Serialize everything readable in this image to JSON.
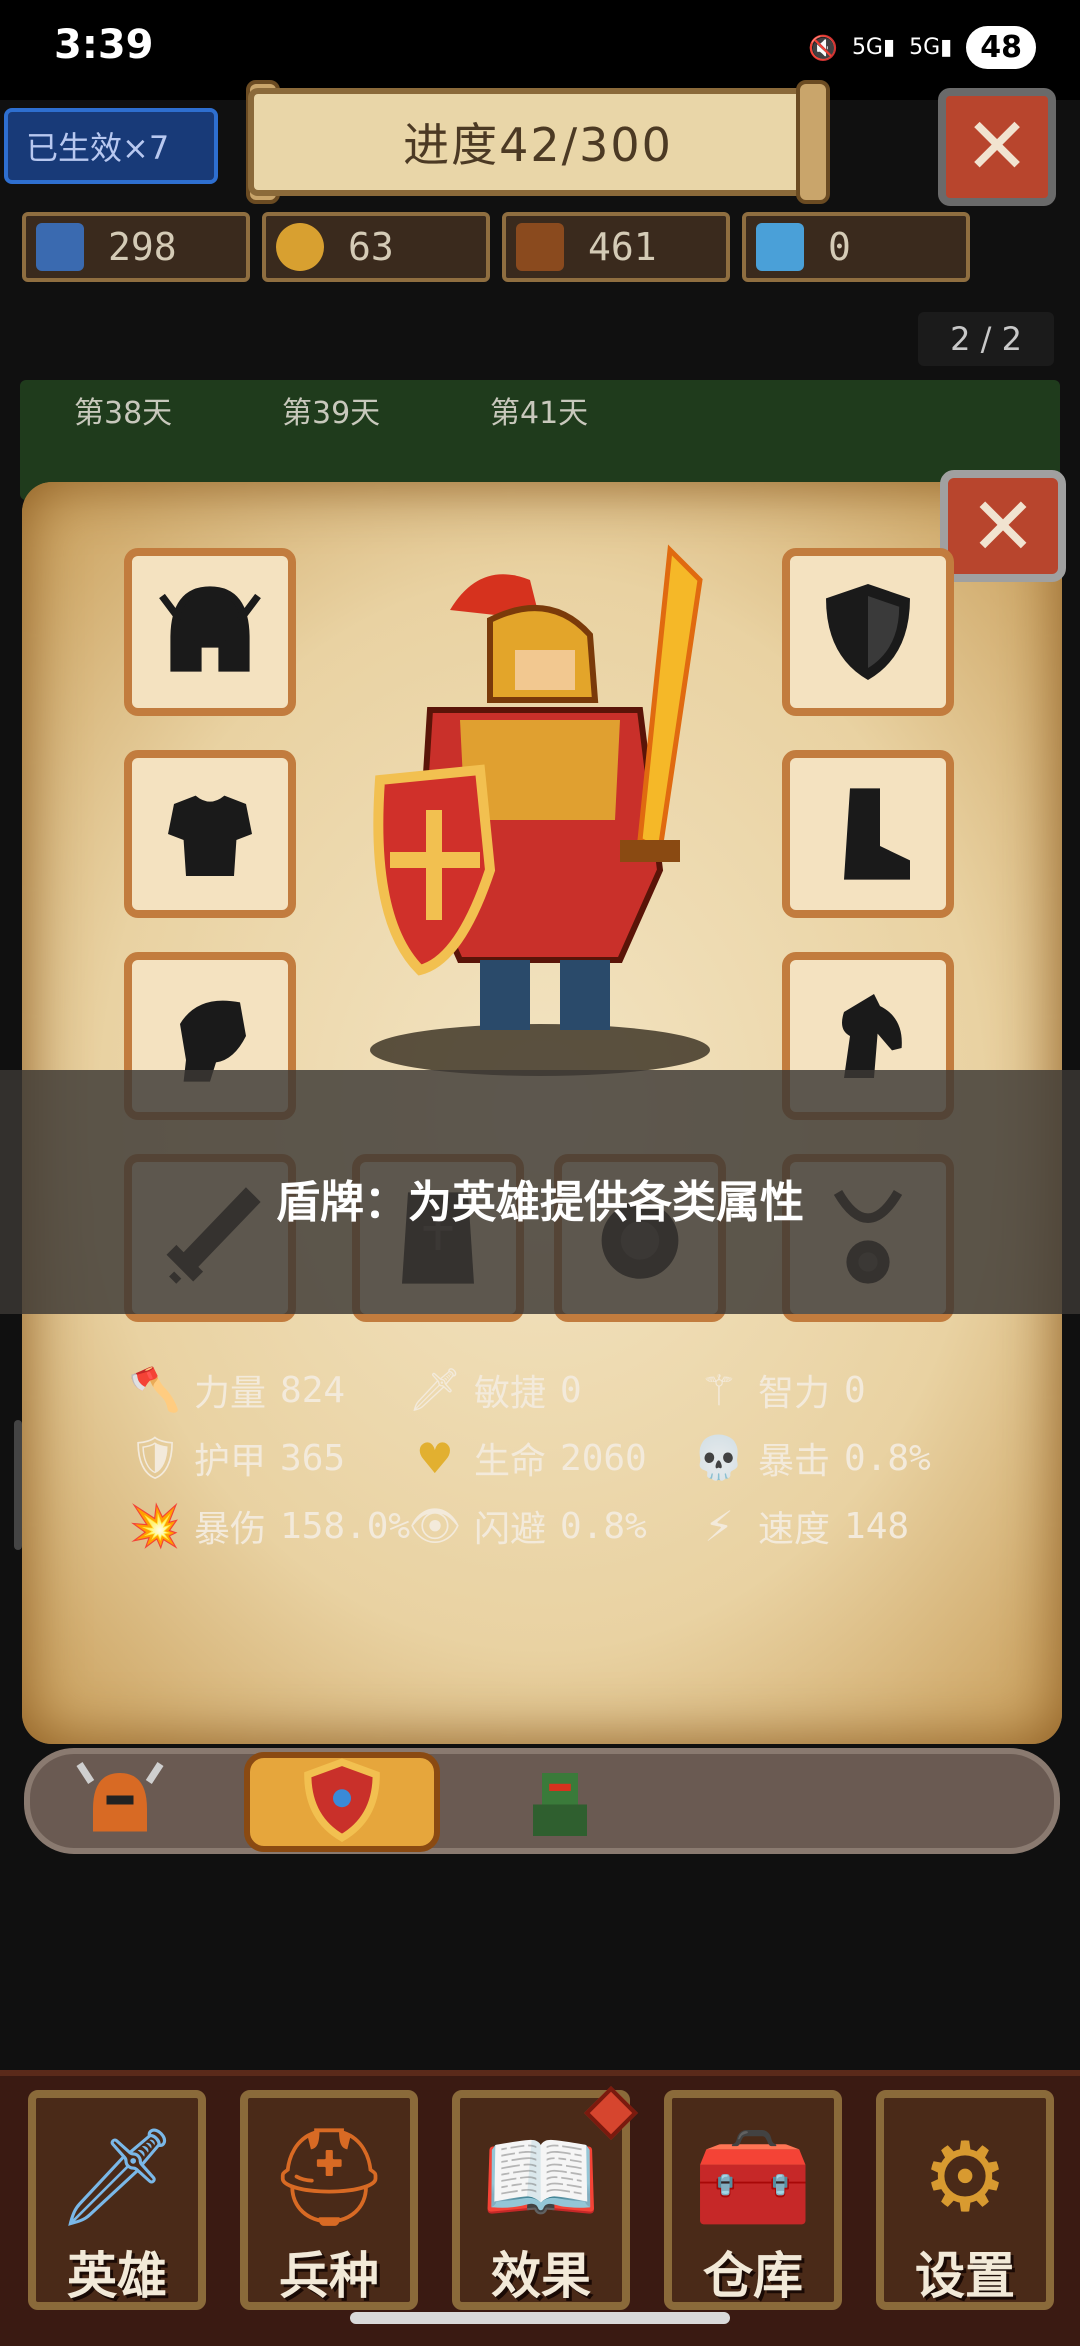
{
  "status": {
    "time": "3:39",
    "net1": "5G",
    "net2": "5G",
    "battery": "48"
  },
  "hud": {
    "buff_label": "已生效×7",
    "progress": "进度42/300",
    "page_indicator": "2 / 2",
    "resources": [
      {
        "icon": "population-icon",
        "value": "298"
      },
      {
        "icon": "gold-coins-icon",
        "value": "63"
      },
      {
        "icon": "wood-logs-icon",
        "value": "461"
      },
      {
        "icon": "key-icon",
        "value": "0"
      }
    ]
  },
  "days": [
    "第38天",
    "第39天",
    "第41天"
  ],
  "equipment": {
    "slots": [
      {
        "name": "helmet-slot",
        "icon": "helmet-icon"
      },
      {
        "name": "armor-slot",
        "icon": "chest-armor-icon"
      },
      {
        "name": "gauntlet-slot",
        "icon": "gauntlet-icon"
      },
      {
        "name": "shield-slot",
        "icon": "shield-icon"
      },
      {
        "name": "boots-slot",
        "icon": "boot-icon"
      },
      {
        "name": "mount-slot",
        "icon": "horse-icon"
      },
      {
        "name": "weapon-slot",
        "icon": "sword-icon"
      },
      {
        "name": "book-slot",
        "icon": "book-icon"
      },
      {
        "name": "ring-slot",
        "icon": "ring-icon"
      },
      {
        "name": "amulet-slot",
        "icon": "amulet-icon"
      }
    ],
    "tooltip": "盾牌：为英雄提供各类属性"
  },
  "stats": [
    {
      "label": "力量",
      "value": "824",
      "icon": "axe-icon"
    },
    {
      "label": "敏捷",
      "value": "0",
      "icon": "dagger-icon"
    },
    {
      "label": "智力",
      "value": "0",
      "icon": "staff-icon"
    },
    {
      "label": "护甲",
      "value": "365",
      "icon": "shield-badge-icon"
    },
    {
      "label": "生命",
      "value": "2060",
      "icon": "heart-icon"
    },
    {
      "label": "暴击",
      "value": "0.8%",
      "icon": "skull-icon"
    },
    {
      "label": "暴伤",
      "value": "158.0%",
      "icon": "explosion-icon"
    },
    {
      "label": "闪避",
      "value": "0.8%",
      "icon": "eye-icon"
    },
    {
      "label": "速度",
      "value": "148",
      "icon": "lightning-icon"
    }
  ],
  "hero_selector": [
    "hero-horned-helm-icon",
    "hero-shield-crest-icon",
    "hero-green-knight-icon"
  ],
  "nav": [
    {
      "label": "英雄",
      "icon": "sword-icon"
    },
    {
      "label": "兵种",
      "icon": "knight-helmet-icon"
    },
    {
      "label": "效果",
      "icon": "spellbook-icon"
    },
    {
      "label": "仓库",
      "icon": "treasure-chest-icon"
    },
    {
      "label": "设置",
      "icon": "gear-icon"
    }
  ],
  "colors": {
    "accent": "#c27c3e",
    "close": "#b8452d",
    "parchment": "#f3e4c2"
  }
}
